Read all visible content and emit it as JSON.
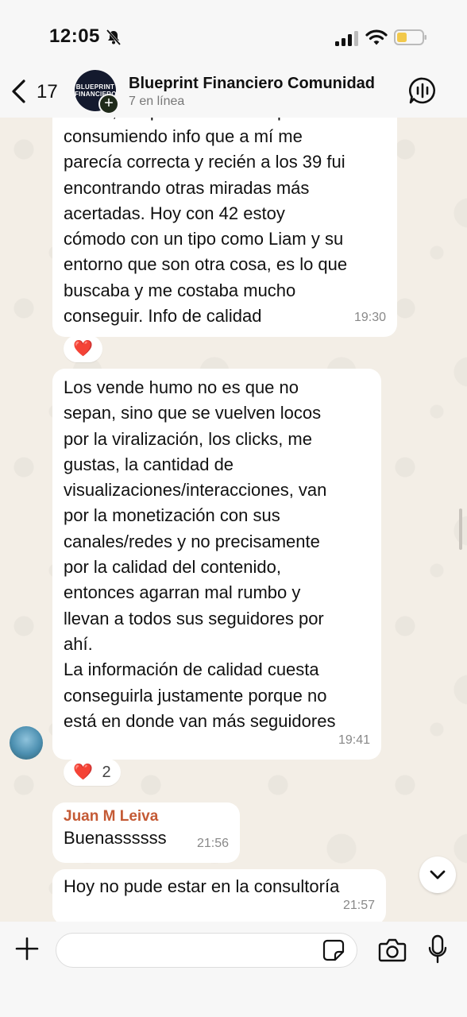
{
  "status_bar": {
    "time": "12:05",
    "icons": [
      "bell-slash-icon",
      "signal-icon",
      "wifi-icon",
      "battery-icon"
    ]
  },
  "header": {
    "back_count": "17",
    "avatar_text_1": "BLUEPRINT",
    "avatar_text_2": "FINANCIERO",
    "group_name": "Blueprint Financiero Comunidad",
    "group_status": "7 en línea"
  },
  "messages": [
    {
      "text_clipped": "tenían, después me desvié por ir",
      "text": "consumiendo info que a mí me\nparecía correcta y recién a los 39 fui\nencontrando otras miradas más\nacertadas. Hoy con 42 estoy\ncómodo con un tipo como Liam y su\nentorno que son otra cosa, es lo que\nbuscaba y me costaba mucho\nconseguir. Info de calidad",
      "time": "19:30",
      "reaction": "❤️",
      "reaction_count": ""
    },
    {
      "text": "Los vende humo no es que no\nsepan, sino que se vuelven locos\npor la viralización, los clicks, me\ngustas, la cantidad de\nvisualizaciones/interacciones, van\npor la monetización con sus\ncanales/redes y no precisamente\npor la calidad del contenido,\nentonces agarran mal rumbo y\nllevan a todos sus seguidores por\nahí.\nLa información de calidad cuesta\nconseguirla justamente porque no\nestá en donde van más seguidores",
      "time": "19:41",
      "reaction": "❤️",
      "reaction_count": "2"
    },
    {
      "sender": "Juan M Leiva",
      "text": "Buenassssss",
      "time": "21:56"
    },
    {
      "text": "Hoy no pude estar en la consultoría",
      "time": "21:57"
    }
  ],
  "composer": {
    "placeholder": "",
    "value": ""
  },
  "colors": {
    "wallpaper": "#f3eee6",
    "bubble": "#ffffff",
    "sender_name": "#c45a35",
    "heart": "#e0212f"
  }
}
